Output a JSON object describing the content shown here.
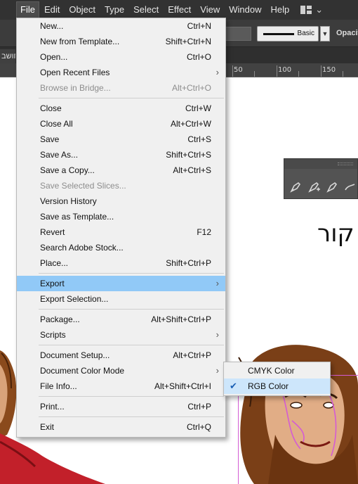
{
  "menubar": {
    "items": [
      "File",
      "Edit",
      "Object",
      "Type",
      "Select",
      "Effect",
      "View",
      "Window",
      "Help"
    ],
    "active_index": 0
  },
  "controlbar": {
    "stroke_style_label": "Basic",
    "opacity_label": "Opacity"
  },
  "tabstrip": {
    "doc_tab_label": "חושב"
  },
  "ruler": {
    "labels": [
      "50",
      "100",
      "150"
    ]
  },
  "canvas": {
    "hebrew_text": "קור"
  },
  "file_menu": {
    "groups": [
      [
        {
          "label": "New...",
          "shortcut": "Ctrl+N"
        },
        {
          "label": "New from Template...",
          "shortcut": "Shift+Ctrl+N"
        },
        {
          "label": "Open...",
          "shortcut": "Ctrl+O"
        },
        {
          "label": "Open Recent Files",
          "shortcut": "",
          "submenu": true
        },
        {
          "label": "Browse in Bridge...",
          "shortcut": "Alt+Ctrl+O",
          "disabled": true
        }
      ],
      [
        {
          "label": "Close",
          "shortcut": "Ctrl+W"
        },
        {
          "label": "Close All",
          "shortcut": "Alt+Ctrl+W"
        },
        {
          "label": "Save",
          "shortcut": "Ctrl+S"
        },
        {
          "label": "Save As...",
          "shortcut": "Shift+Ctrl+S"
        },
        {
          "label": "Save a Copy...",
          "shortcut": "Alt+Ctrl+S"
        },
        {
          "label": "Save Selected Slices...",
          "shortcut": "",
          "disabled": true
        },
        {
          "label": "Version History",
          "shortcut": ""
        },
        {
          "label": "Save as Template...",
          "shortcut": ""
        },
        {
          "label": "Revert",
          "shortcut": "F12"
        },
        {
          "label": "Search Adobe Stock...",
          "shortcut": ""
        },
        {
          "label": "Place...",
          "shortcut": "Shift+Ctrl+P"
        }
      ],
      [
        {
          "label": "Export",
          "shortcut": "",
          "submenu": true,
          "highlight": true
        },
        {
          "label": "Export Selection...",
          "shortcut": ""
        }
      ],
      [
        {
          "label": "Package...",
          "shortcut": "Alt+Shift+Ctrl+P"
        },
        {
          "label": "Scripts",
          "shortcut": "",
          "submenu": true
        }
      ],
      [
        {
          "label": "Document Setup...",
          "shortcut": "Alt+Ctrl+P"
        },
        {
          "label": "Document Color Mode",
          "shortcut": "",
          "submenu": true
        },
        {
          "label": "File Info...",
          "shortcut": "Alt+Shift+Ctrl+I"
        }
      ],
      [
        {
          "label": "Print...",
          "shortcut": "Ctrl+P"
        }
      ],
      [
        {
          "label": "Exit",
          "shortcut": "Ctrl+Q"
        }
      ]
    ]
  },
  "color_mode_submenu": {
    "items": [
      {
        "label": "CMYK Color",
        "checked": false
      },
      {
        "label": "RGB Color",
        "checked": true
      }
    ]
  },
  "colors": {
    "menubar_bg": "#323232",
    "menu_bg": "#f0f0f0",
    "highlight": "#91c9f7",
    "artboard_guide": "#d45bd4"
  }
}
